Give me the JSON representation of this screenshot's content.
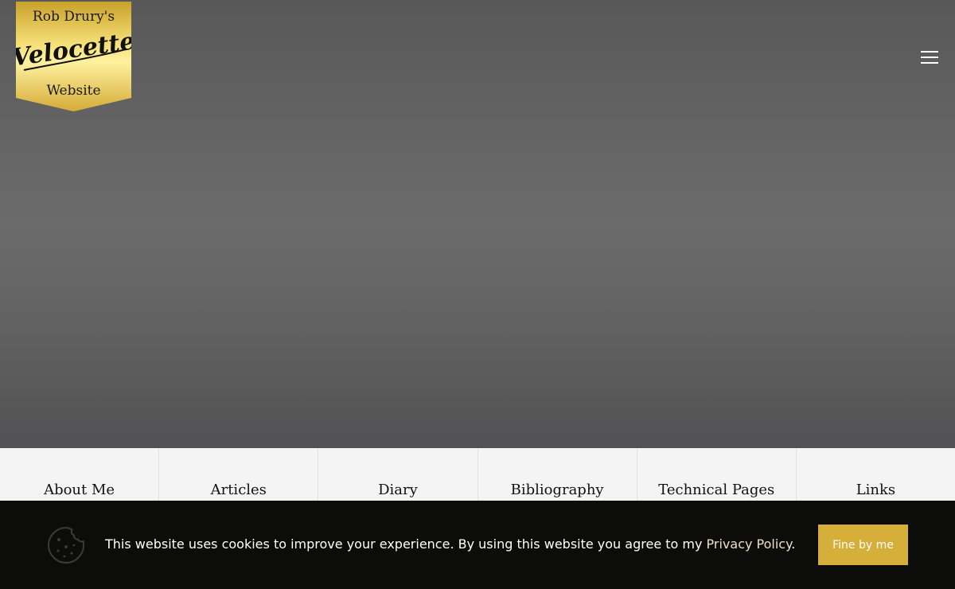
{
  "logo": {
    "line1": "Rob Drury's",
    "brand": "Velocette",
    "line3": "Website",
    "gold_light": "#f7e27a",
    "gold_dark": "#c9a12a"
  },
  "header": {
    "menu_icon": "hamburger-menu-icon"
  },
  "nav": {
    "items": [
      {
        "label": "About Me"
      },
      {
        "label": "Articles"
      },
      {
        "label": "Diary"
      },
      {
        "label": "Bibliography"
      },
      {
        "label": "Technical Pages"
      },
      {
        "label": "Links"
      }
    ]
  },
  "cookie": {
    "icon": "cookie-icon",
    "text_before": "This website uses cookies to improve your experience. By using this website you agree to my ",
    "link_label": "Privacy Policy",
    "text_after": ".",
    "button_label": "Fine by me",
    "button_color": "#d6ae3a"
  }
}
